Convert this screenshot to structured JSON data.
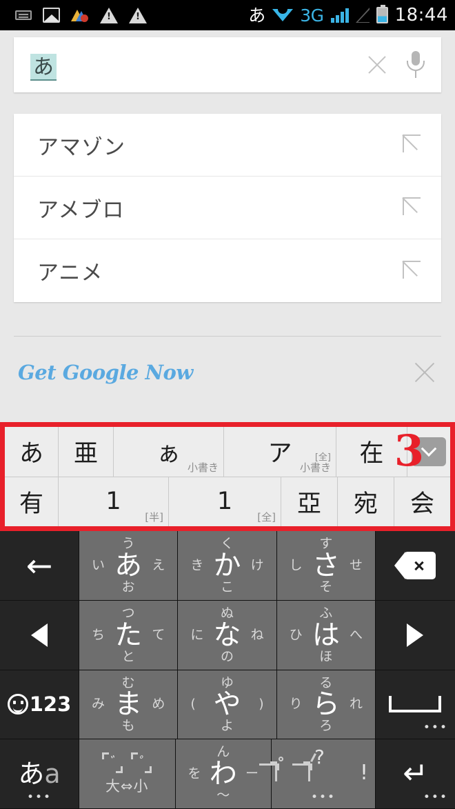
{
  "statusbar": {
    "icons_left": [
      "keyboard-icon",
      "photo-icon",
      "colorful-app-icon",
      "warning-icon",
      "warning-icon"
    ],
    "ime_indicator": "あ",
    "network_label": "3G",
    "clock": "18:44",
    "icons_right": [
      "wifi-icon",
      "signal-bars-icon",
      "signal-empty-icon",
      "battery-icon"
    ]
  },
  "search": {
    "value": "あ",
    "clear_icon": "close-icon",
    "voice_icon": "microphone-icon"
  },
  "suggestions": {
    "items": [
      {
        "text": "アマゾン",
        "icon": "arrow-northwest-icon"
      },
      {
        "text": "アメブロ",
        "icon": "arrow-northwest-icon"
      },
      {
        "text": "アニメ",
        "icon": "arrow-northwest-icon"
      }
    ]
  },
  "google_now": {
    "label": "Get Google Now",
    "dismiss_icon": "close-icon",
    "color": "#5aa9e0"
  },
  "candidate_bar": {
    "annotation_number": "3",
    "annotation_color": "#e8202a",
    "expand_icon": "chevron-down-icon",
    "rows": [
      [
        {
          "main": "あ",
          "tag": "",
          "note": ""
        },
        {
          "main": "亜",
          "tag": "",
          "note": ""
        },
        {
          "main": "ぁ",
          "tag": "",
          "note": "小書き"
        },
        {
          "main": "ア",
          "tag": "[全]",
          "note": "小書き"
        },
        {
          "main": "在",
          "tag": "",
          "note": ""
        }
      ],
      [
        {
          "main": "有",
          "tag": "",
          "note": ""
        },
        {
          "main": "1",
          "tag": "",
          "note": "[半]"
        },
        {
          "main": "1",
          "tag": "",
          "note": "[全]"
        },
        {
          "main": "亞",
          "tag": "",
          "note": ""
        },
        {
          "main": "宛",
          "tag": "",
          "note": ""
        },
        {
          "main": "会",
          "tag": "",
          "note": ""
        }
      ]
    ]
  },
  "keyboard": {
    "rows": [
      [
        {
          "name": "back-key",
          "glyph": "back-arrow-icon",
          "center": "",
          "up": "",
          "down": "",
          "left": "",
          "right": "",
          "dots": ""
        },
        {
          "name": "key-a",
          "glyph": "",
          "center": "あ",
          "up": "う",
          "down": "お",
          "left": "い",
          "right": "え",
          "dots": ""
        },
        {
          "name": "key-ka",
          "glyph": "",
          "center": "か",
          "up": "く",
          "down": "こ",
          "left": "き",
          "right": "け",
          "dots": ""
        },
        {
          "name": "key-sa",
          "glyph": "",
          "center": "さ",
          "up": "す",
          "down": "そ",
          "left": "し",
          "right": "せ",
          "dots": ""
        },
        {
          "name": "delete-key",
          "glyph": "delete-icon",
          "center": "",
          "up": "",
          "down": "",
          "left": "",
          "right": "",
          "dots": ""
        }
      ],
      [
        {
          "name": "cursor-left-key",
          "glyph": "triangle-left-icon",
          "center": "",
          "up": "",
          "down": "",
          "left": "",
          "right": "",
          "dots": ""
        },
        {
          "name": "key-ta",
          "glyph": "",
          "center": "た",
          "up": "つ",
          "down": "と",
          "left": "ち",
          "right": "て",
          "dots": ""
        },
        {
          "name": "key-na",
          "glyph": "",
          "center": "な",
          "up": "ぬ",
          "down": "の",
          "left": "に",
          "right": "ね",
          "dots": ""
        },
        {
          "name": "key-ha",
          "glyph": "",
          "center": "は",
          "up": "ふ",
          "down": "ほ",
          "left": "ひ",
          "right": "へ",
          "dots": ""
        },
        {
          "name": "cursor-right-key",
          "glyph": "triangle-right-icon",
          "center": "",
          "up": "",
          "down": "",
          "left": "",
          "right": "",
          "dots": ""
        }
      ],
      [
        {
          "name": "symbols-key",
          "glyph": "emoji-123-icon",
          "center": "123",
          "up": "",
          "down": "",
          "left": "",
          "right": "",
          "dots": ""
        },
        {
          "name": "key-ma",
          "glyph": "",
          "center": "ま",
          "up": "む",
          "down": "も",
          "left": "み",
          "right": "め",
          "dots": ""
        },
        {
          "name": "key-ya",
          "glyph": "",
          "center": "や",
          "up": "ゆ",
          "down": "よ",
          "left": "(",
          "right": ")",
          "dots": ""
        },
        {
          "name": "key-ra",
          "glyph": "",
          "center": "ら",
          "up": "る",
          "down": "ろ",
          "left": "り",
          "right": "れ",
          "dots": ""
        },
        {
          "name": "space-key",
          "glyph": "space-icon",
          "center": "",
          "up": "",
          "down": "",
          "left": "",
          "right": "",
          "dots": "•••"
        }
      ],
      [
        {
          "name": "ime-switch-key",
          "glyph": "ime-switch-icon",
          "center": "あa",
          "up": "",
          "down": "",
          "left": "",
          "right": "",
          "dots": "•••"
        },
        {
          "name": "dakuten-size-key",
          "glyph": "dakuten-size-icon",
          "center": "大⇔小",
          "up": "",
          "down": "",
          "left": "",
          "right": "",
          "dots": ""
        },
        {
          "name": "key-wa",
          "glyph": "",
          "center": "わ",
          "up": "ん",
          "down": "〜",
          "left": "を",
          "right": "ー",
          "dots": ""
        },
        {
          "name": "punctuation-key",
          "glyph": "punctuation-icon",
          "center": "",
          "up": "?",
          "down": "",
          "left": "。",
          "right": "!",
          "dots": "•••"
        },
        {
          "name": "enter-key",
          "glyph": "enter-icon",
          "center": "",
          "up": "",
          "down": "",
          "left": "",
          "right": "",
          "dots": "•••"
        }
      ]
    ]
  }
}
